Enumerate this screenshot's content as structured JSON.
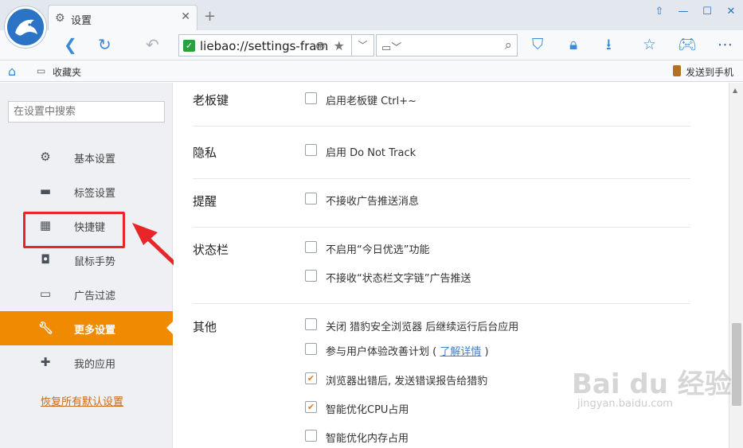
{
  "tab": {
    "title": "设置",
    "icon": "gear-icon",
    "close": "✕",
    "new_tab": "+"
  },
  "window_controls": [
    "⇧",
    "—",
    "☐",
    "✕"
  ],
  "toolbar": {
    "url": "liebao://settings-frame/",
    "search_engine_icon": "page-icon"
  },
  "bookmarks": {
    "favorites": "收藏夹",
    "send_to_phone": "发送到手机"
  },
  "sidebar": {
    "search_placeholder": "在设置中搜索",
    "items": [
      {
        "label": "基本设置",
        "icon": "gear-icon",
        "active": false
      },
      {
        "label": "标签设置",
        "icon": "tab-icon",
        "active": false
      },
      {
        "label": "快捷键",
        "icon": "keyboard-icon",
        "active": false
      },
      {
        "label": "鼠标手势",
        "icon": "mouse-icon",
        "active": false
      },
      {
        "label": "广告过滤",
        "icon": "window-icon",
        "active": false
      },
      {
        "label": "更多设置",
        "icon": "wrench-icon",
        "active": true
      },
      {
        "label": "我的应用",
        "icon": "puzzle-icon",
        "active": false
      }
    ],
    "restore_defaults": "恢复所有默认设置"
  },
  "sections": {
    "boss_key": {
      "title": "老板键",
      "options": [
        {
          "label": "启用老板键  Ctrl+~",
          "checked": false
        }
      ]
    },
    "privacy": {
      "title": "隐私",
      "options": [
        {
          "label": "启用 Do Not Track",
          "checked": false
        }
      ]
    },
    "reminder": {
      "title": "提醒",
      "options": [
        {
          "label": "不接收广告推送消息",
          "checked": false
        }
      ]
    },
    "statusbar": {
      "title": "状态栏",
      "options": [
        {
          "label": "不启用“今日优选”功能",
          "checked": false
        },
        {
          "label": "不接收“状态栏文字链”广告推送",
          "checked": false
        }
      ]
    },
    "other": {
      "title": "其他",
      "options": [
        {
          "label": "关闭 猎豹安全浏览器 后继续运行后台应用",
          "checked": false
        },
        {
          "label": "参与用户体验改善计划",
          "link": "了解详情",
          "checked": false
        },
        {
          "label": "浏览器出错后, 发送错误报告给猎豹",
          "checked": true
        },
        {
          "label": "智能优化CPU占用",
          "checked": true
        },
        {
          "label": "智能优化内存占用",
          "checked": false
        }
      ]
    }
  },
  "watermark": {
    "main": "Bai du 经验",
    "sub": "jingyan.baidu.com"
  },
  "colors": {
    "accent": "#f08a00",
    "highlight": "#e8262a",
    "link": "#c96b1c"
  }
}
